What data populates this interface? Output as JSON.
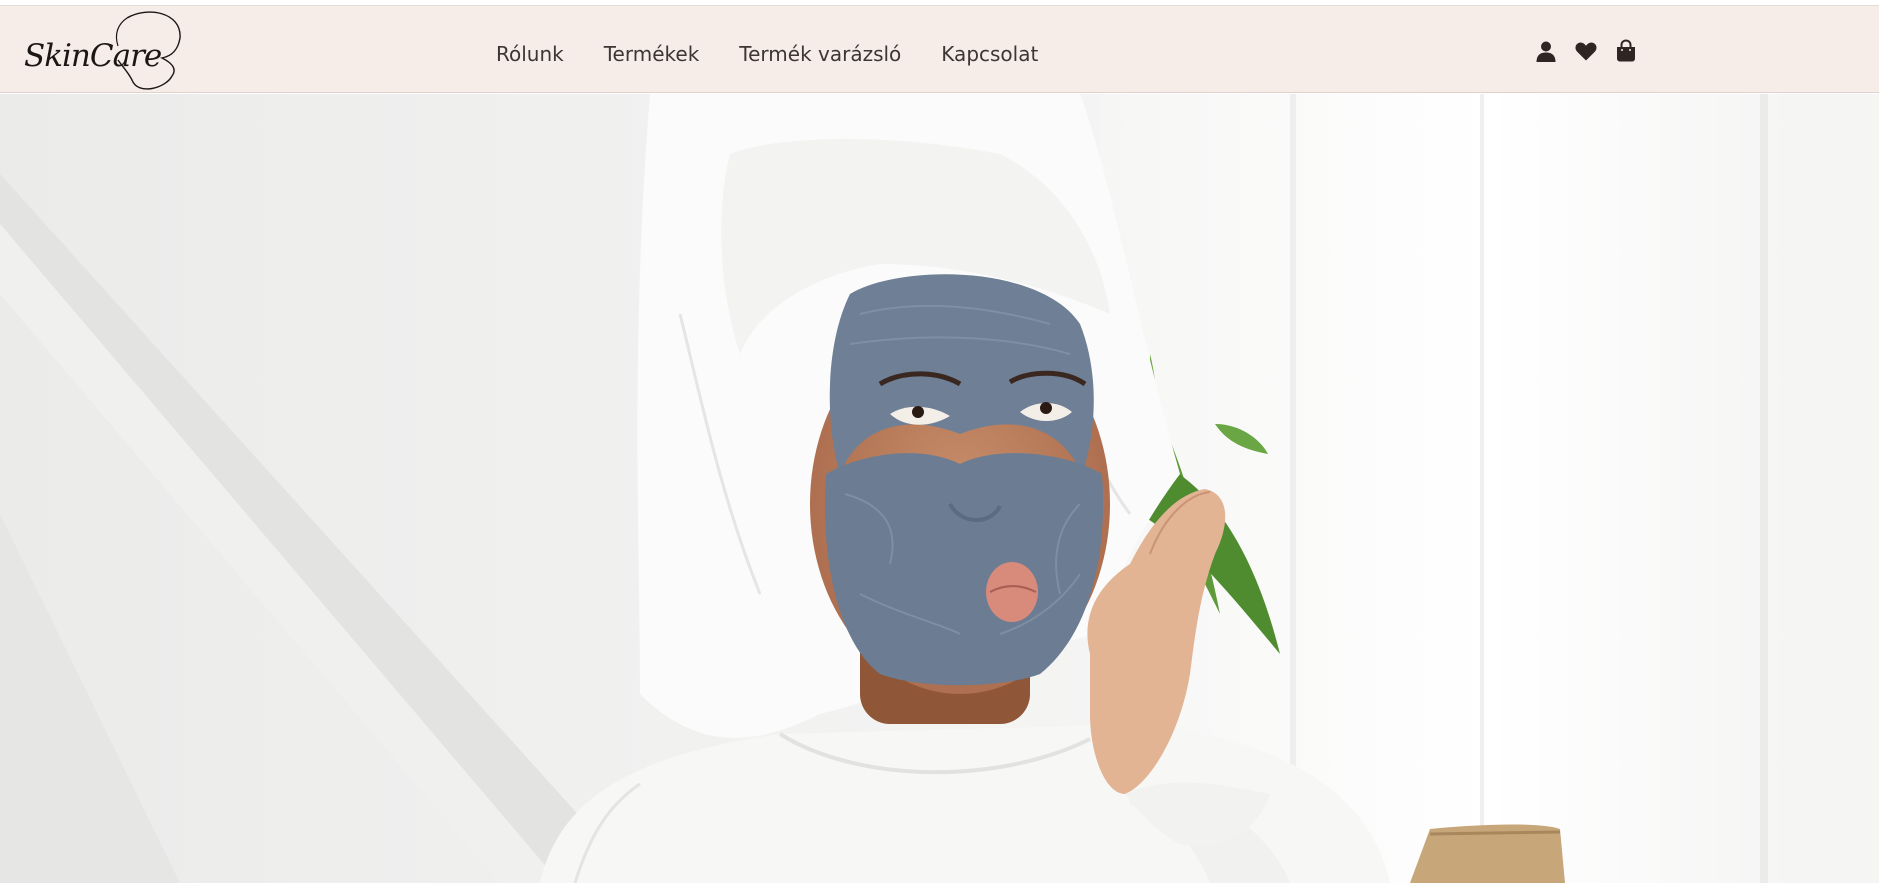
{
  "brand": {
    "logo_text": "SkinCare"
  },
  "nav": {
    "items": [
      {
        "label": "Rólunk"
      },
      {
        "label": "Termékek"
      },
      {
        "label": "Termék varázsló"
      },
      {
        "label": "Kapcsolat"
      }
    ]
  },
  "header_icons": [
    "user-icon",
    "heart-icon",
    "shopping-bag-icon"
  ],
  "colors": {
    "navbar_bg": "#f6ede8",
    "nav_text": "#3e3634",
    "icon": "#2f2523"
  }
}
